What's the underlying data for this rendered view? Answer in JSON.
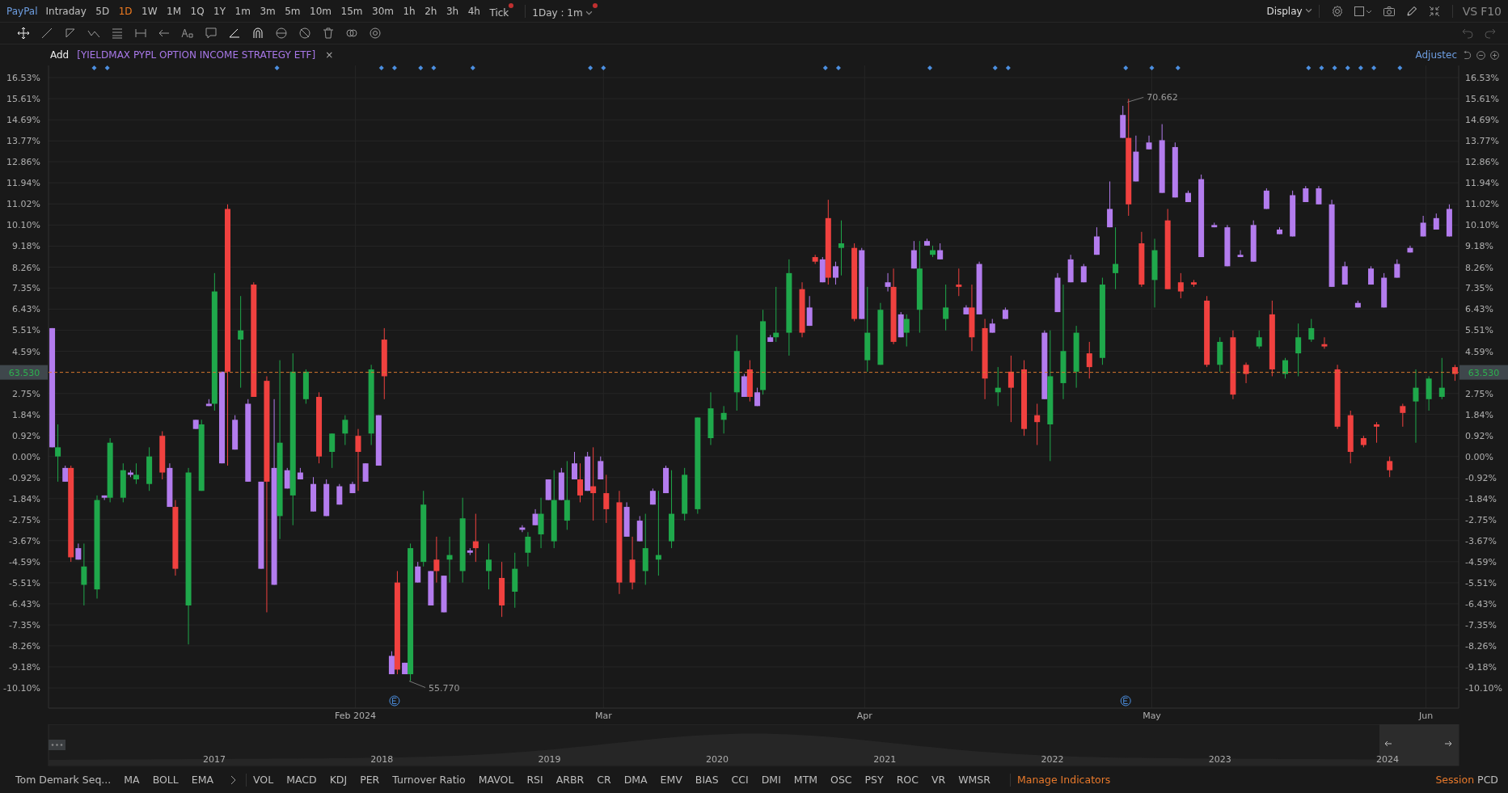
{
  "toolbar": {
    "symbol": "PayPal",
    "intervals": [
      {
        "label": "Intraday",
        "selected": false,
        "dot": false
      },
      {
        "label": "5D",
        "selected": false,
        "dot": false
      },
      {
        "label": "1D",
        "selected": true,
        "dot": false
      },
      {
        "label": "1W",
        "selected": false,
        "dot": false
      },
      {
        "label": "1M",
        "selected": false,
        "dot": false
      },
      {
        "label": "1Q",
        "selected": false,
        "dot": false
      },
      {
        "label": "1Y",
        "selected": false,
        "dot": false
      },
      {
        "label": "1m",
        "selected": false,
        "dot": false
      },
      {
        "label": "3m",
        "selected": false,
        "dot": false
      },
      {
        "label": "5m",
        "selected": false,
        "dot": false
      },
      {
        "label": "10m",
        "selected": false,
        "dot": false
      },
      {
        "label": "15m",
        "selected": false,
        "dot": false
      },
      {
        "label": "30m",
        "selected": false,
        "dot": false
      },
      {
        "label": "1h",
        "selected": false,
        "dot": false
      },
      {
        "label": "2h",
        "selected": false,
        "dot": false
      },
      {
        "label": "3h",
        "selected": false,
        "dot": false
      },
      {
        "label": "4h",
        "selected": false,
        "dot": false
      },
      {
        "label": "Tick",
        "selected": false,
        "dot": true
      }
    ],
    "session": {
      "label": "1Day : 1m",
      "dot": true
    },
    "display": "Display",
    "vs": "VS",
    "f10": "F10"
  },
  "compare": {
    "add": "Add",
    "name": "[YIELDMAX PYPL OPTION INCOME STRATEGY ETF]",
    "close": "×",
    "adjust": "Adjustec"
  },
  "chart": {
    "price_tags": [
      "63.530",
      "63.530"
    ],
    "chart_data": {
      "type": "candlestick",
      "grid": true,
      "ylim": [
        -10.98,
        17.06
      ],
      "categories": [
        null,
        null,
        null,
        null,
        null,
        null,
        null,
        null,
        null,
        null,
        null,
        null,
        null,
        null,
        null,
        null,
        null,
        null,
        null,
        null,
        null,
        null,
        null,
        "Feb 2024",
        null,
        null,
        null,
        null,
        null,
        null,
        null,
        null,
        null,
        null,
        null,
        null,
        null,
        null,
        null,
        null,
        null,
        null,
        "Mar",
        null,
        null,
        null,
        null,
        null,
        null,
        null,
        null,
        null,
        null,
        null,
        null,
        null,
        null,
        null,
        null,
        null,
        null,
        null,
        "Apr",
        null,
        null,
        null,
        null,
        null,
        null,
        null,
        null,
        null,
        null,
        null,
        null,
        null,
        null,
        null,
        null,
        null,
        null,
        null,
        null,
        null,
        "May",
        null,
        null,
        null,
        null,
        null,
        null,
        null,
        null,
        null,
        null,
        null,
        null,
        null,
        null,
        null,
        null,
        null,
        null,
        null,
        null,
        "Jun",
        null,
        null
      ],
      "yticks": [
        {
          "value": 16.53,
          "label": "16.53%"
        },
        {
          "value": 15.61,
          "label": "15.61%"
        },
        {
          "value": 14.69,
          "label": "14.69%"
        },
        {
          "value": 13.77,
          "label": "13.77%"
        },
        {
          "value": 12.86,
          "label": "12.86%"
        },
        {
          "value": 11.94,
          "label": "11.94%"
        },
        {
          "value": 11.02,
          "label": "11.02%"
        },
        {
          "value": 10.1,
          "label": "10.10%"
        },
        {
          "value": 9.18,
          "label": "9.18%"
        },
        {
          "value": 8.26,
          "label": "8.26%"
        },
        {
          "value": 7.35,
          "label": "7.35%"
        },
        {
          "value": 6.43,
          "label": "6.43%"
        },
        {
          "value": 5.51,
          "label": "5.51%"
        },
        {
          "value": 4.59,
          "label": "4.59%"
        },
        {
          "value": 2.75,
          "label": "2.75%"
        },
        {
          "value": 1.84,
          "label": "1.84%"
        },
        {
          "value": 0.92,
          "label": "0.92%"
        },
        {
          "value": 0,
          "label": "0.00%"
        },
        {
          "value": -0.92,
          "label": "-0.92%"
        },
        {
          "value": -1.84,
          "label": "-1.84%"
        },
        {
          "value": -2.75,
          "label": "-2.75%"
        },
        {
          "value": -3.67,
          "label": "-3.67%"
        },
        {
          "value": -4.59,
          "label": "-4.59%"
        },
        {
          "value": -5.51,
          "label": "-5.51%"
        },
        {
          "value": -6.43,
          "label": "-6.43%"
        },
        {
          "value": -7.35,
          "label": "-7.35%"
        },
        {
          "value": -8.26,
          "label": "-8.26%"
        },
        {
          "value": -9.18,
          "label": "-9.18%"
        },
        {
          "value": -10.1,
          "label": "-10.10%"
        }
      ],
      "series": [
        {
          "ohlc": [
            [
              0.0,
              1.4,
              -1.1,
              0.4
            ],
            [
              -0.5,
              -0.4,
              -4.6,
              -4.4
            ],
            [
              -5.6,
              -3.8,
              -6.5,
              -4.8
            ],
            [
              -5.8,
              -1.7,
              -6.2,
              -1.9
            ],
            [
              -1.8,
              0.8,
              -2.0,
              0.6
            ],
            [
              -1.8,
              -0.3,
              -2.0,
              -0.6
            ],
            [
              -1.0,
              -0.3,
              -1.2,
              -0.8
            ],
            [
              -1.2,
              0.4,
              -1.5,
              0.0
            ],
            [
              0.9,
              1.1,
              -1.0,
              -0.7
            ],
            [
              -2.2,
              -1.9,
              -5.2,
              -4.9
            ],
            [
              -6.5,
              -0.5,
              -8.2,
              -0.7
            ],
            [
              -1.5,
              1.6,
              -1.5,
              1.4
            ],
            [
              2.3,
              8.0,
              2.0,
              7.2
            ],
            [
              10.8,
              11.0,
              -0.4,
              3.7
            ],
            [
              5.1,
              7.0,
              3.0,
              5.5
            ],
            [
              7.5,
              7.6,
              2.6,
              2.6
            ],
            [
              3.3,
              3.5,
              -6.8,
              -1.1
            ],
            [
              -2.6,
              4.2,
              -3.6,
              0.6
            ],
            [
              -1.7,
              4.5,
              -3.0,
              3.7
            ],
            [
              2.5,
              3.8,
              2.3,
              3.7
            ],
            [
              2.6,
              2.8,
              -0.3,
              0.0
            ],
            [
              0.2,
              1.0,
              -0.5,
              1.0
            ],
            [
              1.0,
              1.8,
              0.5,
              1.6
            ],
            [
              0.9,
              1.2,
              -1.5,
              0.2
            ],
            [
              1.0,
              4.0,
              0.5,
              3.8
            ],
            [
              5.1,
              5.6,
              2.5,
              3.5
            ],
            [
              -5.5,
              -5.0,
              -9.5,
              -9.3
            ],
            [
              -9.5,
              -3.8,
              -9.8,
              -4.0
            ],
            [
              -4.6,
              -1.5,
              -4.8,
              -2.1
            ],
            [
              -4.5,
              -3.5,
              -5.5,
              -5.0
            ],
            [
              -4.5,
              -3.5,
              -5.5,
              -4.3
            ],
            [
              -5.0,
              -1.8,
              -5.5,
              -2.7
            ],
            [
              -3.7,
              -2.5,
              -4.6,
              -4.0
            ],
            [
              -5.0,
              -3.8,
              -5.8,
              -4.5
            ],
            [
              -5.3,
              -4.6,
              -7.0,
              -6.5
            ],
            [
              -5.9,
              -4.2,
              -6.6,
              -4.9
            ],
            [
              -4.2,
              -3.3,
              -4.8,
              -3.5
            ],
            [
              -3.4,
              -1.8,
              -4.0,
              -2.5
            ],
            [
              -3.7,
              -0.6,
              -4.0,
              -1.9
            ],
            [
              -2.8,
              -0.2,
              -3.2,
              -1.9
            ],
            [
              -1.0,
              -0.3,
              -2.0,
              -1.7
            ],
            [
              -1.3,
              0.4,
              -2.8,
              -1.6
            ],
            [
              -1.6,
              -0.8,
              -2.9,
              -2.3
            ],
            [
              -2.0,
              -1.5,
              -6.0,
              -5.5
            ],
            [
              -4.5,
              -3.5,
              -5.8,
              -5.5
            ],
            [
              -5.0,
              -2.5,
              -5.6,
              -4.0
            ],
            [
              -4.5,
              -1.5,
              -5.2,
              -4.3
            ],
            [
              -3.7,
              -0.6,
              -4.0,
              -2.5
            ],
            [
              -2.5,
              -0.5,
              -2.8,
              -0.8
            ],
            [
              -2.3,
              1.7,
              -2.5,
              1.7
            ],
            [
              0.8,
              2.8,
              0.5,
              2.1
            ],
            [
              1.6,
              2.2,
              1.0,
              1.9
            ],
            [
              2.8,
              5.3,
              2.0,
              4.6
            ],
            [
              3.8,
              4.2,
              2.4,
              2.6
            ],
            [
              2.9,
              6.4,
              2.7,
              5.9
            ],
            [
              5.2,
              7.4,
              5.0,
              5.4
            ],
            [
              5.4,
              8.6,
              4.4,
              8.0
            ],
            [
              7.3,
              7.6,
              5.2,
              5.4
            ],
            [
              8.7,
              8.8,
              8.4,
              8.5
            ],
            [
              10.4,
              11.2,
              7.5,
              7.8
            ],
            [
              9.1,
              10.3,
              7.9,
              9.3
            ],
            [
              9.1,
              9.3,
              5.9,
              6.0
            ],
            [
              4.2,
              7.4,
              3.7,
              5.4
            ],
            [
              4.0,
              6.7,
              4.0,
              6.4
            ],
            [
              7.4,
              8.2,
              4.9,
              5.0
            ],
            [
              5.4,
              6.2,
              4.8,
              6.0
            ],
            [
              6.4,
              9.4,
              5.4,
              8.2
            ],
            [
              8.8,
              9.2,
              8.7,
              9.0
            ],
            [
              6.0,
              7.5,
              5.5,
              6.5
            ],
            [
              7.5,
              8.2,
              7.0,
              7.4
            ],
            [
              6.5,
              7.5,
              4.6,
              5.2
            ],
            [
              5.6,
              6.0,
              2.5,
              3.4
            ],
            [
              2.8,
              3.9,
              2.2,
              3.0
            ],
            [
              3.7,
              4.4,
              1.5,
              3.0
            ],
            [
              3.8,
              4.2,
              0.9,
              1.2
            ],
            [
              1.8,
              2.3,
              0.5,
              1.5
            ],
            [
              1.4,
              5.5,
              -0.2,
              3.5
            ],
            [
              3.2,
              7.5,
              2.5,
              4.6
            ],
            [
              3.7,
              5.7,
              3.0,
              5.4
            ],
            [
              4.5,
              5.0,
              3.4,
              3.9
            ],
            [
              4.3,
              7.8,
              4.0,
              7.5
            ],
            [
              8.0,
              10.0,
              7.3,
              8.4
            ],
            [
              13.9,
              15.6,
              10.5,
              11.0
            ],
            [
              9.3,
              9.8,
              7.4,
              7.5
            ],
            [
              7.7,
              9.5,
              6.5,
              9.0
            ],
            [
              10.3,
              10.8,
              7.3,
              7.3
            ],
            [
              7.6,
              8.0,
              6.9,
              7.2
            ],
            [
              7.6,
              7.7,
              7.4,
              7.5
            ],
            [
              6.8,
              7.0,
              3.9,
              4.0
            ],
            [
              4.0,
              5.2,
              3.7,
              5.0
            ],
            [
              5.2,
              5.5,
              2.5,
              2.7
            ],
            [
              4.0,
              4.1,
              3.2,
              3.6
            ],
            [
              4.8,
              5.5,
              4.7,
              5.2
            ],
            [
              6.2,
              6.8,
              3.5,
              3.8
            ],
            [
              3.6,
              4.3,
              3.4,
              4.2
            ],
            [
              4.5,
              5.8,
              3.5,
              5.2
            ],
            [
              5.1,
              6.0,
              5.0,
              5.6
            ],
            [
              4.9,
              5.2,
              4.7,
              4.8
            ],
            [
              3.8,
              4.0,
              1.2,
              1.3
            ],
            [
              1.8,
              2.0,
              -0.3,
              0.2
            ],
            [
              0.8,
              0.9,
              0.4,
              0.5
            ],
            [
              1.4,
              1.5,
              0.6,
              1.3
            ],
            [
              -0.2,
              0.0,
              -0.9,
              -0.6
            ],
            [
              2.2,
              2.3,
              1.3,
              1.9
            ],
            [
              2.4,
              3.8,
              0.6,
              3.0
            ],
            [
              2.5,
              3.5,
              2.0,
              3.4
            ],
            [
              2.6,
              4.3,
              2.5,
              3.0
            ],
            [
              3.9,
              4.0,
              3.3,
              3.6
            ]
          ]
        },
        {
          "color": "#b37cee",
          "ohlc": [
            [
              5.6,
              5.6,
              0.4,
              0.4
            ],
            [
              -0.5,
              -0.4,
              -1.1,
              -1.1
            ],
            [
              -4.0,
              -3.8,
              -4.5,
              -4.5
            ],
            null,
            [
              -1.7,
              -1.7,
              -1.9,
              -1.8
            ],
            null,
            [
              -0.7,
              -0.6,
              -0.9,
              -0.8
            ],
            null,
            null,
            [
              -0.5,
              -0.3,
              -2.2,
              -2.2
            ],
            null,
            [
              1.6,
              1.6,
              1.2,
              1.2
            ],
            [
              2.3,
              2.5,
              2.2,
              2.2
            ],
            [
              3.7,
              3.7,
              -0.3,
              -0.3
            ],
            [
              1.6,
              1.8,
              0.3,
              0.3
            ],
            [
              2.3,
              2.5,
              -1.1,
              -1.1
            ],
            [
              -1.1,
              -1.1,
              -4.9,
              -4.9
            ],
            [
              -0.5,
              2.5,
              -5.6,
              -5.6
            ],
            [
              -0.6,
              -0.5,
              -1.4,
              -1.4
            ],
            [
              -0.7,
              -0.5,
              -1.0,
              -1.0
            ],
            [
              -1.2,
              -0.9,
              -2.4,
              -2.4
            ],
            [
              -1.2,
              -1.0,
              -2.6,
              -2.6
            ],
            [
              -1.3,
              -1.2,
              -2.1,
              -2.1
            ],
            [
              -1.2,
              -1.1,
              -1.6,
              -1.6
            ],
            [
              -0.3,
              -0.3,
              -1.1,
              -1.1
            ],
            [
              1.8,
              1.8,
              -0.4,
              -0.4
            ],
            [
              -8.7,
              -8.5,
              -9.5,
              -9.5
            ],
            [
              -9.0,
              -9.0,
              -9.5,
              -9.5
            ],
            [
              -4.8,
              -4.6,
              -5.5,
              -5.5
            ],
            [
              -5.0,
              -5.0,
              -6.5,
              -6.5
            ],
            [
              -5.2,
              -5.2,
              -6.8,
              -6.8
            ],
            null,
            [
              -4.1,
              -4.0,
              -4.3,
              -4.2
            ],
            null,
            null,
            null,
            [
              -3.1,
              -3.0,
              -3.3,
              -3.2
            ],
            [
              -2.5,
              -2.3,
              -3.0,
              -3.0
            ],
            [
              -1.0,
              -1.0,
              -1.9,
              -1.9
            ],
            [
              -0.7,
              -0.5,
              -1.9,
              -1.9
            ],
            [
              -0.3,
              0.2,
              -1.0,
              -1.0
            ],
            [
              0.0,
              0.2,
              -1.5,
              -1.5
            ],
            [
              -0.2,
              0.0,
              -1.0,
              -1.0
            ],
            null,
            [
              -2.2,
              -2.0,
              -3.5,
              -3.5
            ],
            [
              -2.8,
              -2.6,
              -3.7,
              -3.7
            ],
            [
              -1.5,
              -1.4,
              -2.1,
              -2.1
            ],
            [
              -0.5,
              -0.4,
              -1.6,
              -1.6
            ],
            null,
            null,
            null,
            null,
            null,
            [
              3.5,
              3.6,
              2.6,
              2.6
            ],
            [
              2.8,
              3.0,
              2.2,
              2.2
            ],
            [
              5.2,
              5.3,
              5.0,
              5.0
            ],
            null,
            null,
            [
              6.5,
              7.0,
              5.7,
              5.7
            ],
            [
              8.6,
              8.7,
              7.6,
              7.6
            ],
            [
              8.3,
              8.5,
              7.5,
              7.8
            ],
            null,
            [
              9.0,
              9.1,
              6.0,
              6.0
            ],
            null,
            [
              7.6,
              8.0,
              7.2,
              7.4
            ],
            [
              6.2,
              6.3,
              5.2,
              5.2
            ],
            [
              9.0,
              9.4,
              8.2,
              8.2
            ],
            [
              9.4,
              9.5,
              9.2,
              9.2
            ],
            [
              9.0,
              9.3,
              8.6,
              8.6
            ],
            null,
            [
              6.5,
              6.6,
              6.2,
              6.2
            ],
            [
              8.4,
              8.5,
              6.2,
              6.2
            ],
            [
              5.8,
              6.0,
              5.4,
              5.4
            ],
            [
              6.4,
              6.5,
              6.0,
              6.0
            ],
            null,
            null,
            [
              5.4,
              5.5,
              2.5,
              2.5
            ],
            [
              7.8,
              8.0,
              6.3,
              6.3
            ],
            [
              8.6,
              8.8,
              7.6,
              7.6
            ],
            [
              8.3,
              8.4,
              7.6,
              7.6
            ],
            [
              9.6,
              10.0,
              8.8,
              8.8
            ],
            [
              10.8,
              12.0,
              10.0,
              10.0
            ],
            [
              14.9,
              15.3,
              13.9,
              13.9
            ],
            [
              13.3,
              14.0,
              12.0,
              12.0
            ],
            [
              13.7,
              14.0,
              13.4,
              13.4
            ],
            [
              13.8,
              14.5,
              11.5,
              11.5
            ],
            [
              13.5,
              13.7,
              11.3,
              11.3
            ],
            [
              11.5,
              11.6,
              11.1,
              11.1
            ],
            [
              12.1,
              12.3,
              8.7,
              8.7
            ],
            [
              10.1,
              10.2,
              10.0,
              10.0
            ],
            [
              10.0,
              10.1,
              8.3,
              8.3
            ],
            [
              8.8,
              9.0,
              8.7,
              8.7
            ],
            [
              10.1,
              10.3,
              8.5,
              8.5
            ],
            [
              11.6,
              11.7,
              10.8,
              10.8
            ],
            [
              9.9,
              10.0,
              9.7,
              9.7
            ],
            [
              11.4,
              11.6,
              9.6,
              9.6
            ],
            [
              11.7,
              11.8,
              11.1,
              11.1
            ],
            [
              11.7,
              11.8,
              11.0,
              11.0
            ],
            [
              11.0,
              11.2,
              7.4,
              7.4
            ],
            [
              8.3,
              8.5,
              7.5,
              7.5
            ],
            [
              6.7,
              6.8,
              6.5,
              6.5
            ],
            [
              8.2,
              8.3,
              7.5,
              7.5
            ],
            [
              7.8,
              8.0,
              6.5,
              6.5
            ],
            [
              8.4,
              8.6,
              7.8,
              7.8
            ],
            [
              9.1,
              9.2,
              8.9,
              8.9
            ],
            [
              10.2,
              10.5,
              9.6,
              9.6
            ],
            [
              10.4,
              10.6,
              9.9,
              9.9
            ],
            [
              10.8,
              11.0,
              9.6,
              9.6
            ]
          ]
        }
      ],
      "ref_lines": [
        {
          "axis": "y",
          "value": 3.67
        }
      ],
      "annotations": [
        "70.662",
        "55.770"
      ]
    }
  },
  "navigator": {
    "years": [
      "2017",
      "2018",
      "2019",
      "2020",
      "2021",
      "2022",
      "2023",
      "2024"
    ]
  },
  "indicators": {
    "main": [
      "Tom Demark Seq...",
      "MA",
      "BOLL",
      "EMA"
    ],
    "sub": [
      "VOL",
      "MACD",
      "KDJ",
      "PER",
      "Turnover Ratio",
      "MAVOL",
      "RSI",
      "ARBR",
      "CR",
      "DMA",
      "EMV",
      "BIAS",
      "CCI",
      "DMI",
      "MTM",
      "OSC",
      "PSY",
      "ROC",
      "VR",
      "WMSR"
    ],
    "manage": "Manage Indicators",
    "session": "Session",
    "pcd": "PCD"
  }
}
